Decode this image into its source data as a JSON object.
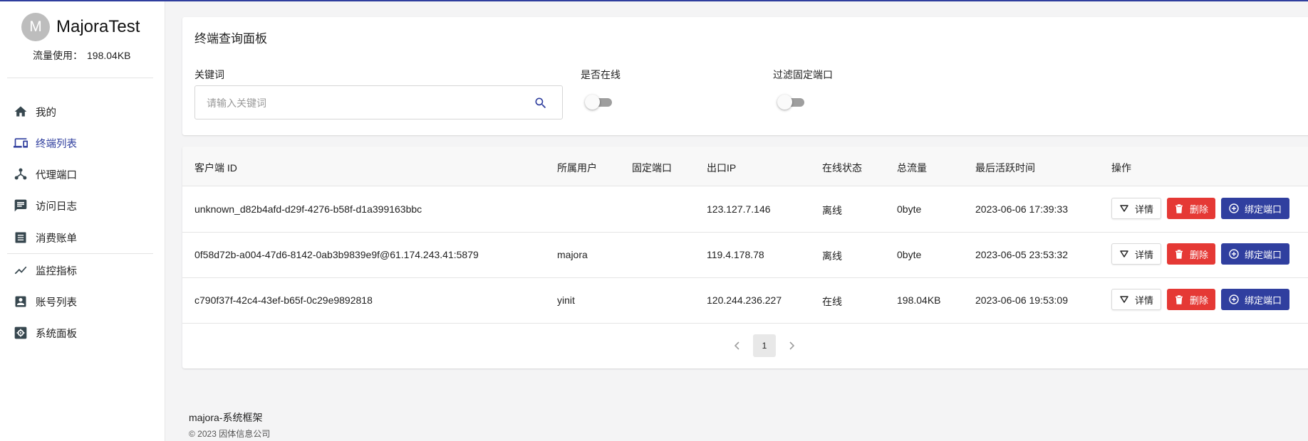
{
  "user": {
    "avatar_letter": "M",
    "name": "MajoraTest",
    "traffic_label": "流量使用：",
    "traffic_value": "198.04KB"
  },
  "nav": {
    "items": [
      {
        "label": "我的",
        "icon": "home-icon"
      },
      {
        "label": "终端列表",
        "icon": "devices-icon"
      },
      {
        "label": "代理端口",
        "icon": "hub-icon"
      },
      {
        "label": "访问日志",
        "icon": "chat-icon"
      },
      {
        "label": "消费账单",
        "icon": "list-icon"
      },
      {
        "label": "监控指标",
        "icon": "trend-icon"
      },
      {
        "label": "账号列表",
        "icon": "account-box-icon"
      },
      {
        "label": "系统面板",
        "icon": "settings-box-icon"
      }
    ],
    "active_index": 1
  },
  "filter": {
    "title": "终端查询面板",
    "keyword_label": "关键词",
    "keyword_placeholder": "请输入关键词",
    "keyword_value": "",
    "online_label": "是否在线",
    "online_on": false,
    "fixed_port_label": "过滤固定端口",
    "fixed_port_on": false
  },
  "table": {
    "headers": {
      "client_id": "客户端 ID",
      "user": "所属用户",
      "fixed_port": "固定端口",
      "exit_ip": "出口IP",
      "status": "在线状态",
      "traffic": "总流量",
      "last_active": "最后活跃时间",
      "actions": "操作"
    },
    "rows": [
      {
        "client_id": "unknown_d82b4afd-d29f-4276-b58f-d1a399163bbc",
        "user": "",
        "fixed_port": "",
        "exit_ip": "123.127.7.146",
        "status": "离线",
        "traffic": "0byte",
        "last_active": "2023-06-06 17:39:33"
      },
      {
        "client_id": "0f58d72b-a004-47d6-8142-0ab3b9839e9f@61.174.243.41:5879",
        "user": "majora",
        "fixed_port": "",
        "exit_ip": "119.4.178.78",
        "status": "离线",
        "traffic": "0byte",
        "last_active": "2023-06-05 23:53:32"
      },
      {
        "client_id": "c790f37f-42c4-43ef-b65f-0c29e9892818",
        "user": "yinit",
        "fixed_port": "",
        "exit_ip": "120.244.236.227",
        "status": "在线",
        "traffic": "198.04KB",
        "last_active": "2023-06-06 19:53:09"
      }
    ],
    "actions": {
      "detail": "详情",
      "delete": "删除",
      "bind": "绑定端口"
    }
  },
  "pagination": {
    "current_page": "1"
  },
  "footer": {
    "brand": "majora-系统框架",
    "copyright": "© 2023 因体信息公司"
  },
  "colors": {
    "primary": "#2f3e9e",
    "danger": "#e53935",
    "sidebar_bg": "#ffffff",
    "page_bg": "#f4f4f5"
  }
}
